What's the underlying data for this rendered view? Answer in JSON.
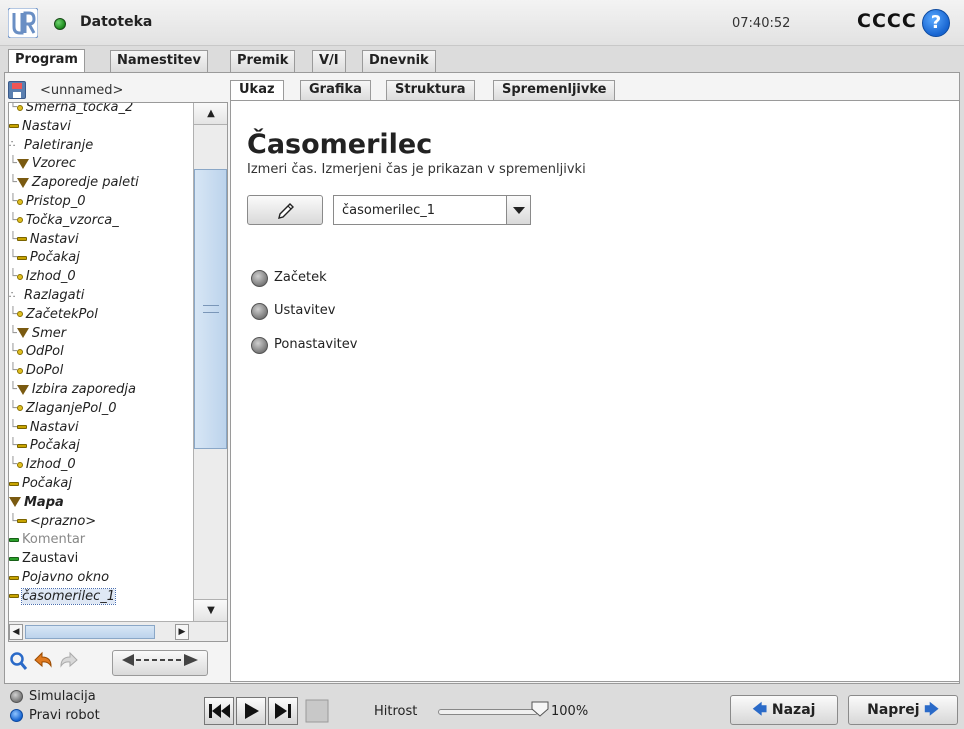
{
  "titlebar": {
    "file_menu": "Datoteka",
    "clock": "07:40:52",
    "robot_name": "CCCC",
    "help": "?"
  },
  "main_tabs": [
    {
      "label": "Program",
      "active": true
    },
    {
      "label": "Namestitev",
      "active": false
    },
    {
      "label": "Premik",
      "active": false
    },
    {
      "label": "V/I",
      "active": false
    },
    {
      "label": "Dnevnik",
      "active": false
    }
  ],
  "program": {
    "name": "<unnamed>"
  },
  "tree": [
    {
      "label": "Smerna_točka_2",
      "icon": "dot",
      "indent": 1
    },
    {
      "label": "Nastavi",
      "icon": "dash",
      "indent": 0
    },
    {
      "label": "Paletiranje",
      "icon": "pal",
      "indent": 0
    },
    {
      "label": "Vzorec",
      "icon": "tri",
      "indent": 1
    },
    {
      "label": "Zaporedje paleti",
      "icon": "tri",
      "indent": 1
    },
    {
      "label": "Pristop_0",
      "icon": "dot",
      "indent": 2
    },
    {
      "label": "Točka_vzorca_",
      "icon": "dot",
      "indent": 2
    },
    {
      "label": "Nastavi",
      "icon": "dash",
      "indent": 2
    },
    {
      "label": "Počakaj",
      "icon": "dash",
      "indent": 2
    },
    {
      "label": "Izhod_0",
      "icon": "dot",
      "indent": 2
    },
    {
      "label": "Razlagati",
      "icon": "pal",
      "indent": 0
    },
    {
      "label": "ZačetekPol",
      "icon": "dot",
      "indent": 1
    },
    {
      "label": "Smer",
      "icon": "tri",
      "indent": 1
    },
    {
      "label": "OdPol",
      "icon": "dot",
      "indent": 2
    },
    {
      "label": "DoPol",
      "icon": "dot",
      "indent": 2
    },
    {
      "label": "Izbira zaporedja",
      "icon": "tri",
      "indent": 1
    },
    {
      "label": "ZlaganjePol_0",
      "icon": "dot",
      "indent": 2
    },
    {
      "label": "Nastavi",
      "icon": "dash",
      "indent": 2
    },
    {
      "label": "Počakaj",
      "icon": "dash",
      "indent": 2
    },
    {
      "label": "Izhod_0",
      "icon": "dot",
      "indent": 2
    },
    {
      "label": "Počakaj",
      "icon": "dash",
      "indent": 0
    },
    {
      "label": "Mapa",
      "icon": "tri",
      "indent": 0,
      "bold": true
    },
    {
      "label": "<prazno>",
      "icon": "dash",
      "indent": 1
    },
    {
      "label": "Komentar",
      "icon": "dash-green",
      "indent": 0,
      "style": "gray"
    },
    {
      "label": "Zaustavi",
      "icon": "dash-green",
      "indent": 0,
      "style": "plain"
    },
    {
      "label": "Pojavno okno",
      "icon": "dash",
      "indent": 0
    },
    {
      "label": "časomerilec_1",
      "icon": "dash",
      "indent": 0,
      "selected": true
    }
  ],
  "sub_tabs": [
    {
      "label": "Ukaz",
      "active": true
    },
    {
      "label": "Grafika",
      "active": false
    },
    {
      "label": "Struktura",
      "active": false
    },
    {
      "label": "Spremenljivke",
      "active": false
    }
  ],
  "command": {
    "title": "Časomerilec",
    "description": "Izmeri čas. Izmerjeni čas je prikazan v spremenljivki",
    "timer_variable": "časomerilec_1",
    "options": [
      "Začetek",
      "Ustavitev",
      "Ponastavitev"
    ]
  },
  "footer": {
    "simulation": "Simulacija",
    "real_robot": "Pravi robot",
    "speed_label": "Hitrost",
    "speed_value": "100%",
    "speed_fraction": 1.0,
    "back": "Nazaj",
    "next": "Naprej"
  },
  "colors": {
    "status_green": "#1b8a1b",
    "help_blue": "#1764d0",
    "tree_yellow": "#c8a400",
    "tree_green": "#2aa02a"
  }
}
